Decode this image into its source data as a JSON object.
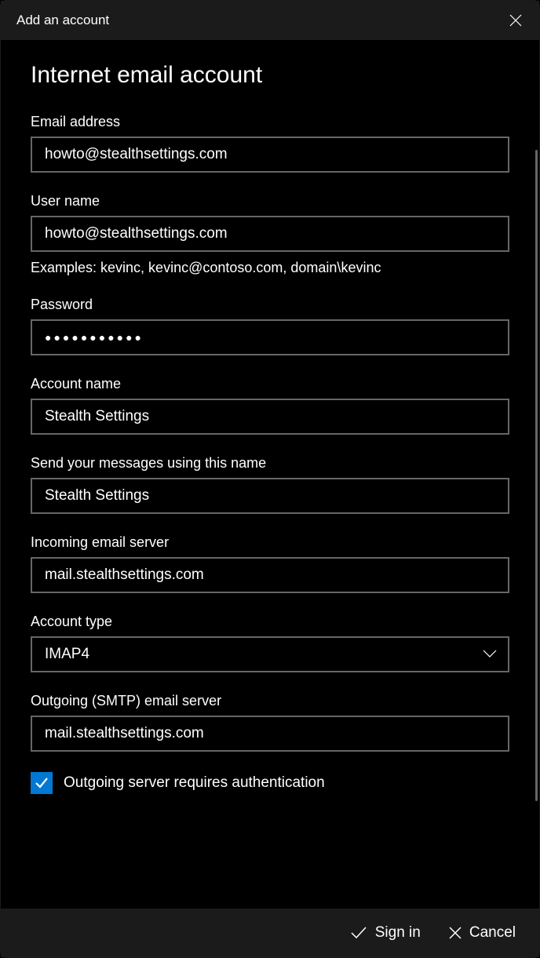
{
  "titlebar": {
    "title": "Add an account"
  },
  "page": {
    "heading": "Internet email account"
  },
  "fields": {
    "email": {
      "label": "Email address",
      "value": "howto@stealthsettings.com"
    },
    "username": {
      "label": "User name",
      "value": "howto@stealthsettings.com",
      "hint": "Examples: kevinc, kevinc@contoso.com, domain\\kevinc"
    },
    "password": {
      "label": "Password",
      "value": "●●●●●●●●●●●"
    },
    "accountName": {
      "label": "Account name",
      "value": "Stealth Settings"
    },
    "senderName": {
      "label": "Send your messages using this name",
      "value": "Stealth Settings"
    },
    "incomingServer": {
      "label": "Incoming email server",
      "value": "mail.stealthsettings.com"
    },
    "accountType": {
      "label": "Account type",
      "value": "IMAP4"
    },
    "outgoingServer": {
      "label": "Outgoing (SMTP) email server",
      "value": "mail.stealthsettings.com"
    },
    "outgoingAuth": {
      "label": "Outgoing server requires authentication",
      "checked": true
    }
  },
  "footer": {
    "signIn": "Sign in",
    "cancel": "Cancel"
  }
}
